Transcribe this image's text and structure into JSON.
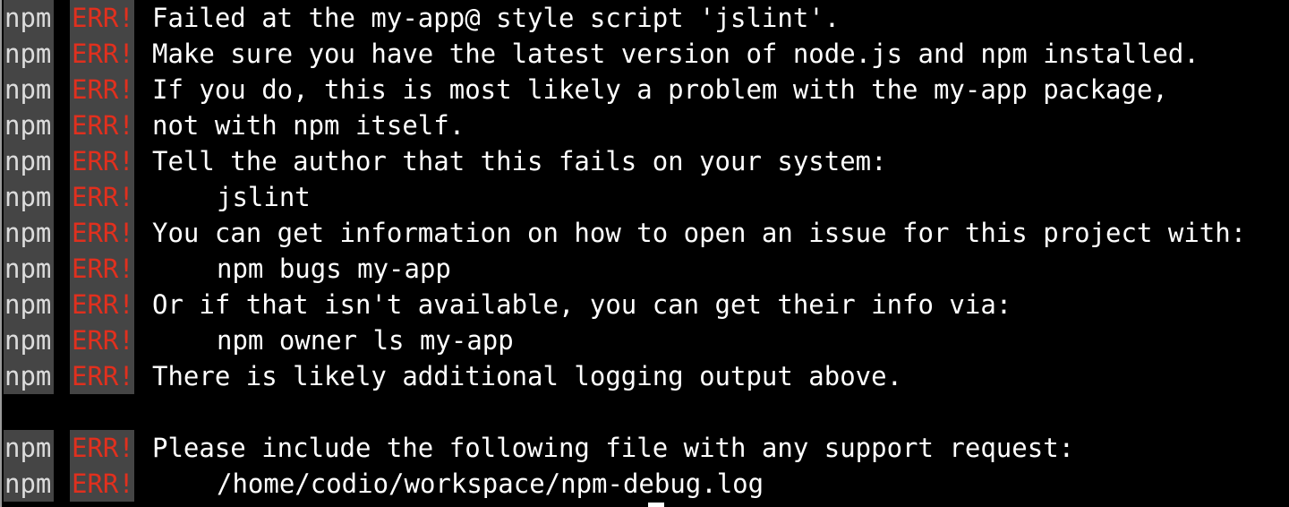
{
  "terminal": {
    "prefix": "npm",
    "level": "ERR!",
    "lines": [
      "Failed at the my-app@ style script 'jslint'.",
      "Make sure you have the latest version of node.js and npm installed.",
      "If you do, this is most likely a problem with the my-app package,",
      "not with npm itself.",
      "Tell the author that this fails on your system:",
      "jslint",
      "You can get information on how to open an issue for this project with:",
      "npm bugs my-app",
      "Or if that isn't available, you can get their info via:",
      "npm owner ls my-app",
      "There is likely additional logging output above.",
      "Please include the following file with any support request:",
      "/home/codio/workspace/npm-debug.log"
    ]
  },
  "colors": {
    "background": "#000000",
    "tag_background": "#454545",
    "err": "#e0301e",
    "text": "#ffffff"
  }
}
